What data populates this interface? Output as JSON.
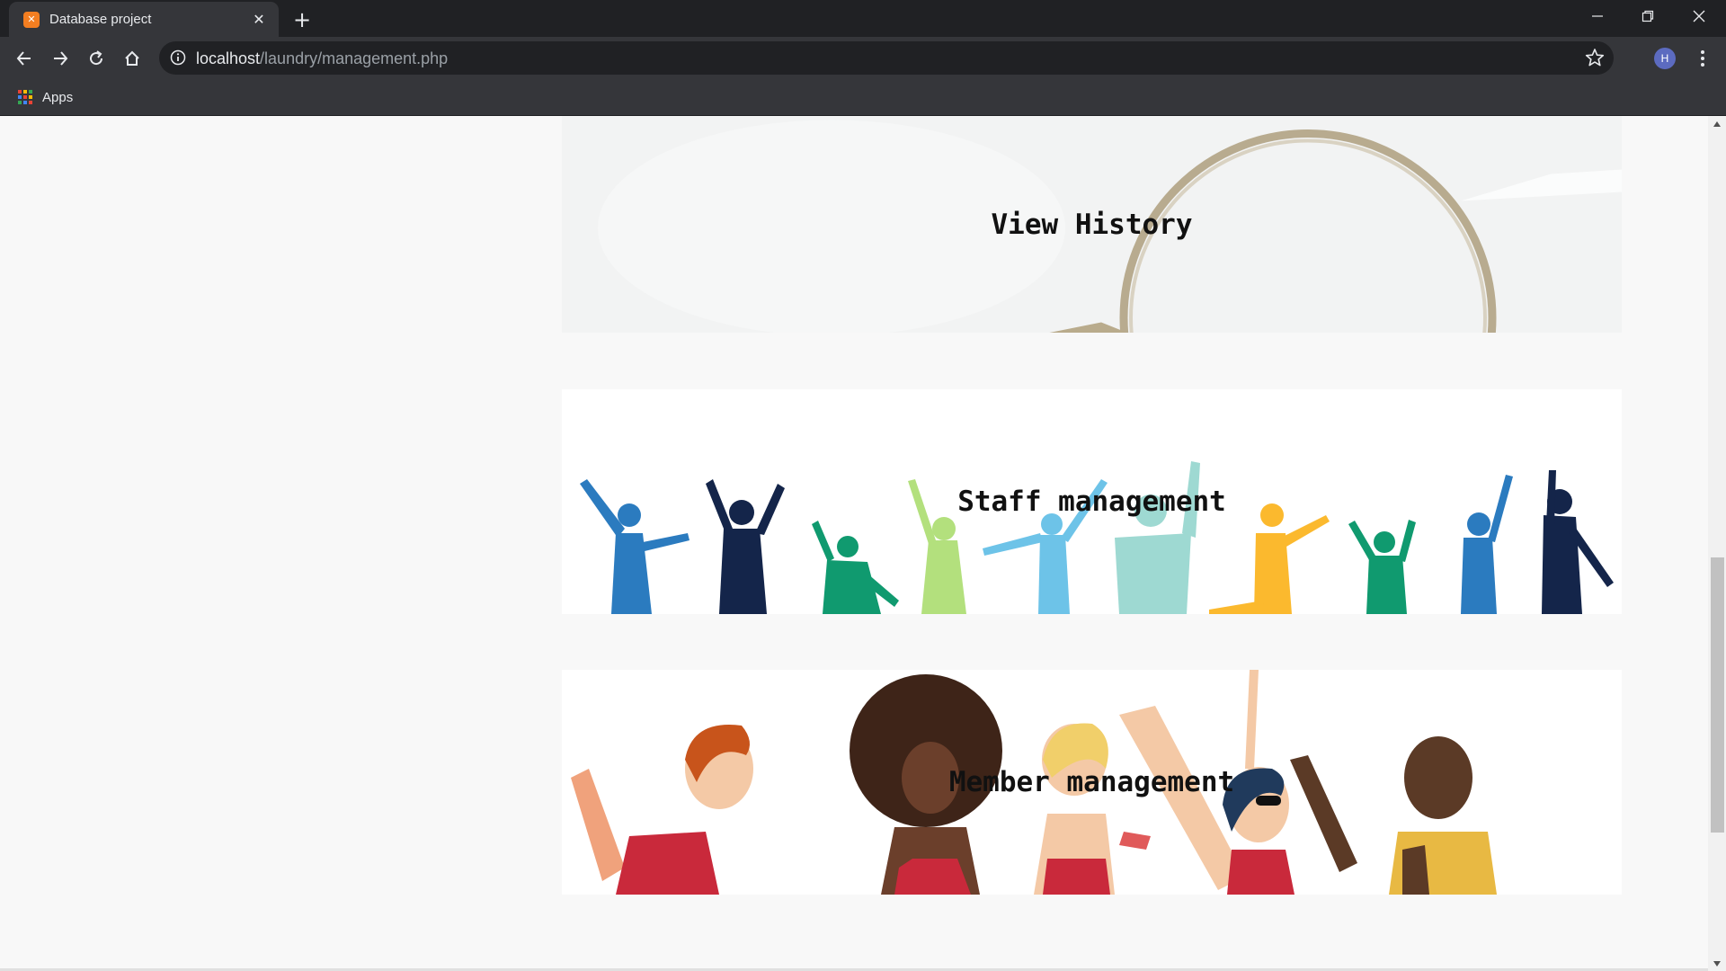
{
  "browser": {
    "tab_title": "Database project",
    "favicon_glyph": "⌘",
    "url_host": "localhost",
    "url_path": "/laundry/management.php",
    "profile_initial": "H",
    "bookmarks_apps": "Apps"
  },
  "page": {
    "cards": [
      {
        "title": "View History"
      },
      {
        "title": "Staff management"
      },
      {
        "title": "Member management"
      }
    ]
  },
  "scrollbar": {
    "position_fraction": 0.55
  },
  "colors": {
    "accent_favicon": "#f37e21",
    "chrome_dark": "#202124",
    "chrome_toolbar": "#35363a",
    "page_bg": "#f8f8f8",
    "avatar": "#5c6bc0"
  }
}
